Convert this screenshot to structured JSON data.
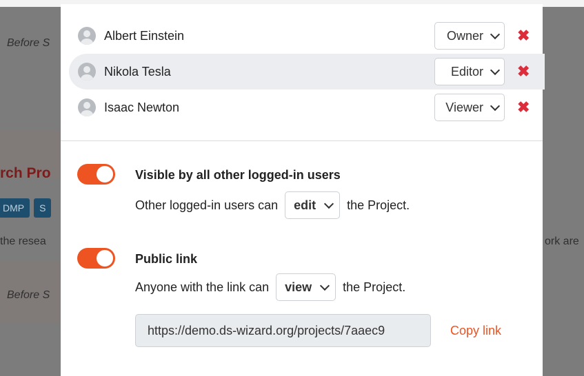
{
  "background": {
    "italic_texts": [
      "Before S",
      "Before S"
    ],
    "heading_fragment": "rch Pro",
    "tags": [
      "DMP",
      "S"
    ],
    "para_left": "the resea",
    "para_right": "ork are"
  },
  "members": [
    {
      "name": "Albert Einstein",
      "role": "Owner"
    },
    {
      "name": "Nikola Tesla",
      "role": "Editor"
    },
    {
      "name": "Isaac Newton",
      "role": "Viewer"
    }
  ],
  "remove_icon": "✖",
  "visibility": {
    "title": "Visible by all other logged-in users",
    "prefix": "Other logged-in users can",
    "value": "edit",
    "suffix": "the Project.",
    "enabled": true
  },
  "public_link": {
    "title": "Public link",
    "prefix": "Anyone with the link can",
    "value": "view",
    "suffix": "the Project.",
    "enabled": true,
    "url": "https://demo.ds-wizard.org/projects/7aaec9",
    "copy_label": "Copy link"
  },
  "colors": {
    "accent": "#ee5322",
    "danger": "#dc2d3c"
  }
}
